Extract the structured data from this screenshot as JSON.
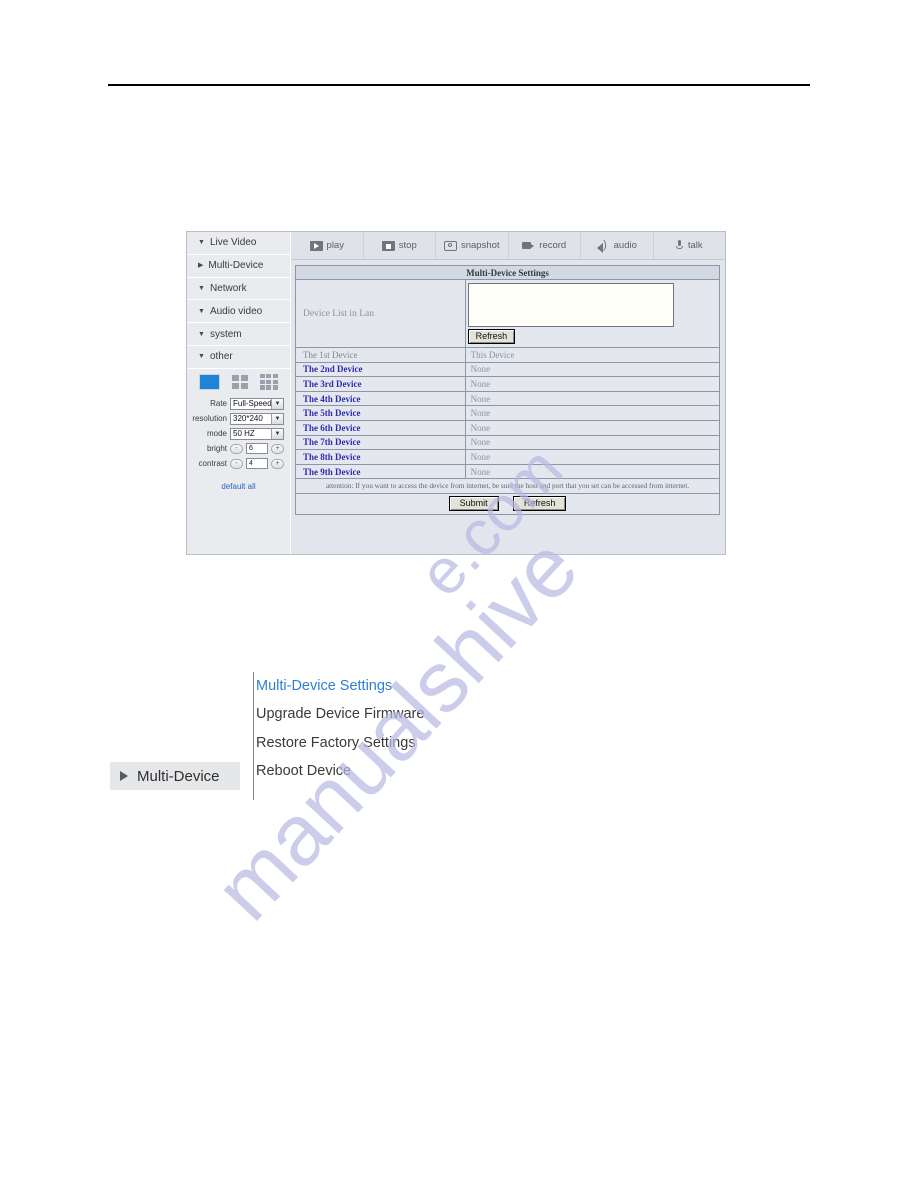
{
  "app": {
    "sidebar": {
      "items": [
        {
          "label": "Live Video",
          "caret": "caret-down-icon"
        },
        {
          "label": "Multi-Device",
          "caret": "caret-right-icon"
        },
        {
          "label": "Network",
          "caret": "caret-down-icon"
        },
        {
          "label": "Audio video",
          "caret": "caret-down-icon"
        },
        {
          "label": "system",
          "caret": "caret-down-icon"
        },
        {
          "label": "other",
          "caret": "caret-down-icon"
        }
      ],
      "layout_icons": [
        "single-view-icon",
        "four-view-grid-icon",
        "nine-view-grid-icon"
      ],
      "controls": {
        "rate": {
          "label": "Rate",
          "value": "Full-Speed"
        },
        "resolution": {
          "label": "resolution",
          "value": "320*240"
        },
        "mode": {
          "label": "mode",
          "value": "50 HZ"
        },
        "bright": {
          "label": "bright",
          "value": "6",
          "minus": "-",
          "plus": "+"
        },
        "contrast": {
          "label": "contrast",
          "value": "4",
          "minus": "-",
          "plus": "+"
        }
      },
      "default_all": "default all"
    },
    "toolbar": [
      {
        "label": "play",
        "icon": "play-icon"
      },
      {
        "label": "stop",
        "icon": "stop-icon"
      },
      {
        "label": "snapshot",
        "icon": "snapshot-icon"
      },
      {
        "label": "record",
        "icon": "record-icon"
      },
      {
        "label": "audio",
        "icon": "audio-speaker-icon"
      },
      {
        "label": "talk",
        "icon": "microphone-icon"
      }
    ],
    "settings": {
      "title": "Multi-Device Settings",
      "lan_label": "Device List in Lan",
      "lan_refresh": "Refresh",
      "devices": [
        {
          "name": "The 1st Device",
          "value": "This Device",
          "is_link": false
        },
        {
          "name": "The 2nd Device",
          "value": "None",
          "is_link": true
        },
        {
          "name": "The 3rd Device",
          "value": "None",
          "is_link": true
        },
        {
          "name": "The 4th Device",
          "value": "None",
          "is_link": true
        },
        {
          "name": "The 5th Device",
          "value": "None",
          "is_link": true
        },
        {
          "name": "The 6th Device",
          "value": "None",
          "is_link": true
        },
        {
          "name": "The 7th Device",
          "value": "None",
          "is_link": true
        },
        {
          "name": "The 8th Device",
          "value": "None",
          "is_link": true
        },
        {
          "name": "The 9th Device",
          "value": "None",
          "is_link": true
        }
      ],
      "attention": "attention: If you want to access the device from internet, be sure the host and port that you set can be accessed from internet.",
      "submit": "Submit",
      "refresh": "Refresh"
    }
  },
  "menu_diagram": {
    "tab_label": "Multi-Device",
    "items": [
      {
        "label": "Multi-Device Settings",
        "active": true
      },
      {
        "label": "Upgrade Device Firmware",
        "active": false
      },
      {
        "label": "Restore Factory Settings",
        "active": false
      },
      {
        "label": "Reboot Device",
        "active": false
      }
    ]
  },
  "watermark": {
    "line_a": "manualshive",
    "line_b": "e.com"
  },
  "colors": {
    "accent_blue": "#2f7fd0",
    "link_blue": "#2c2cb0",
    "selected_view": "#1f83d8",
    "watermark": "#b9b9e4"
  }
}
